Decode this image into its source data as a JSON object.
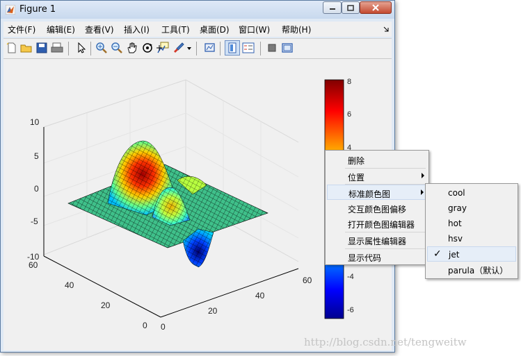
{
  "window": {
    "title": "Figure 1",
    "controls": {
      "minimize": "minimize-icon",
      "maximize": "maximize-icon",
      "close": "close-icon"
    }
  },
  "menubar": [
    {
      "label": "文件(F)"
    },
    {
      "label": "编辑(E)"
    },
    {
      "label": "查看(V)"
    },
    {
      "label": "插入(I)"
    },
    {
      "label": "工具(T)"
    },
    {
      "label": "桌面(D)"
    },
    {
      "label": "窗口(W)"
    },
    {
      "label": "帮助(H)"
    }
  ],
  "toolbar": [
    "new-figure-icon",
    "open-file-icon",
    "save-icon",
    "print-icon",
    "pointer-icon",
    "zoom-in-icon",
    "zoom-out-icon",
    "pan-hand-icon",
    "rotate-3d-icon",
    "data-cursor-icon",
    "brush-icon",
    "link-plot-icon",
    "colorbar-icon",
    "legend-icon",
    "hide-plot-tools-icon",
    "show-plot-tools-icon"
  ],
  "axes": {
    "z_ticks": [
      "10",
      "5",
      "0",
      "-5",
      "-10"
    ],
    "y_ticks": [
      "60",
      "40",
      "20",
      "0"
    ],
    "x_ticks": [
      "0",
      "20",
      "40",
      "60"
    ]
  },
  "colorbar": {
    "ticks": [
      "8",
      "6",
      "4",
      "-4",
      "-6"
    ]
  },
  "context_menu": {
    "items": [
      {
        "label": "删除",
        "submenu": false
      },
      {
        "label": "位置",
        "submenu": true
      },
      {
        "label": "标准颜色图",
        "submenu": true,
        "highlighted": true
      },
      {
        "label": "交互颜色图偏移",
        "submenu": false
      },
      {
        "label": "打开颜色图编辑器",
        "submenu": false
      },
      {
        "label": "显示属性编辑器",
        "submenu": false
      },
      {
        "label": "显示代码",
        "submenu": false
      }
    ]
  },
  "colormap_submenu": {
    "items": [
      {
        "label": "cool",
        "checked": false
      },
      {
        "label": "gray",
        "checked": false
      },
      {
        "label": "hot",
        "checked": false
      },
      {
        "label": "hsv",
        "checked": false
      },
      {
        "label": "jet",
        "checked": true
      },
      {
        "label": "parula（默认）",
        "checked": false
      }
    ],
    "check_glyph": "✓"
  },
  "watermark": "http://blog.csdn.net/tengweitw",
  "colors": {
    "surface_colormap": "jet",
    "menu_highlight": "#e6eef8"
  }
}
